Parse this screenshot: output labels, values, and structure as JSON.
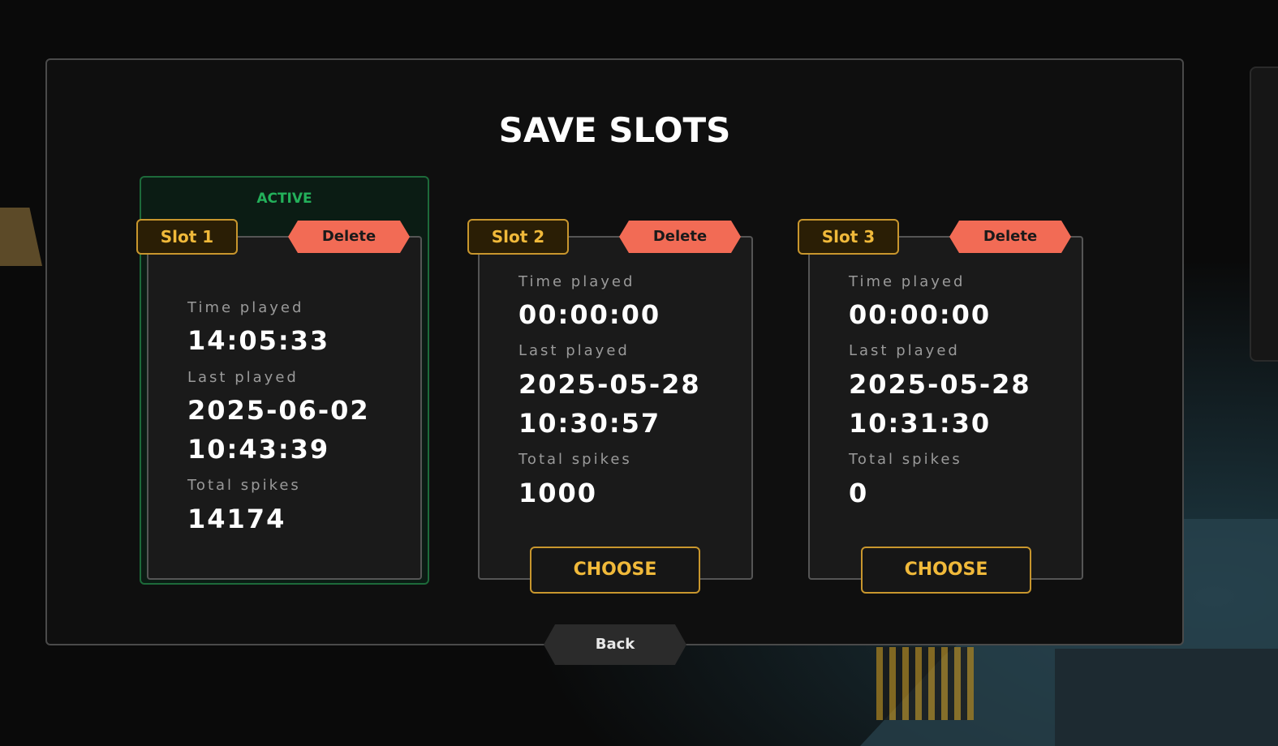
{
  "dialog": {
    "title": "SAVE SLOTS",
    "active_label": "ACTIVE",
    "back_label": "Back"
  },
  "slots": [
    {
      "tag": "Slot 1",
      "delete_label": "Delete",
      "time_played_label": "Time played",
      "time_played": "14:05:33",
      "last_played_label": "Last played",
      "last_played_date": "2025-06-02",
      "last_played_time": "10:43:39",
      "total_spikes_label": "Total spikes",
      "total_spikes": "14174",
      "active": true
    },
    {
      "tag": "Slot 2",
      "delete_label": "Delete",
      "time_played_label": "Time played",
      "time_played": "00:00:00",
      "last_played_label": "Last played",
      "last_played_date": "2025-05-28",
      "last_played_time": "10:30:57",
      "total_spikes_label": "Total spikes",
      "total_spikes": "1000",
      "choose_label": "CHOOSE",
      "active": false
    },
    {
      "tag": "Slot 3",
      "delete_label": "Delete",
      "time_played_label": "Time played",
      "time_played": "00:00:00",
      "last_played_label": "Last played",
      "last_played_date": "2025-05-28",
      "last_played_time": "10:31:30",
      "total_spikes_label": "Total spikes",
      "total_spikes": "0",
      "choose_label": "CHOOSE",
      "active": false
    }
  ],
  "colors": {
    "accent_gold": "#f0b93a",
    "delete_red": "#f26b55",
    "active_green": "#23b05a"
  }
}
